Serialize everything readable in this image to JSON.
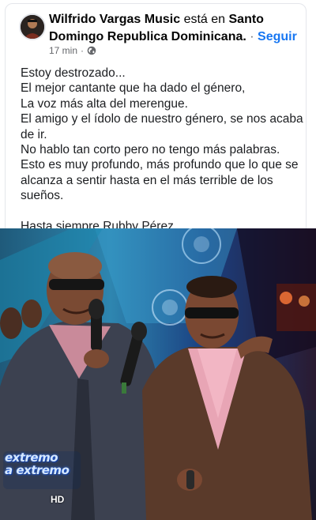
{
  "post": {
    "author": "Wilfrido Vargas Music",
    "connector": " está en ",
    "location": "Santo Domingo Republica Dominicana.",
    "separator": " · ",
    "follow_label": "Seguir",
    "time": "17 min",
    "dot": "·",
    "privacy_icon": "globe-icon",
    "lines": [
      "Estoy destrozado...",
      "El mejor cantante que ha dado el género,",
      "La voz más alta del merengue.",
      "El amigo y el ídolo de nuestro género, se nos acaba de ir.",
      "No hablo tan corto pero no tengo más palabras.",
      "Esto es muy profundo, más profundo que lo que se alcanza a sentir hasta en el más terrible de los sueños."
    ],
    "closing": "Hasta siempre Rubby Pérez."
  },
  "photo": {
    "watermark_line1": "extremo",
    "watermark_line2": "a extremo",
    "badge": "HD"
  },
  "colors": {
    "link": "#1877f2",
    "meta": "#65676b",
    "text": "#1c1e21"
  }
}
